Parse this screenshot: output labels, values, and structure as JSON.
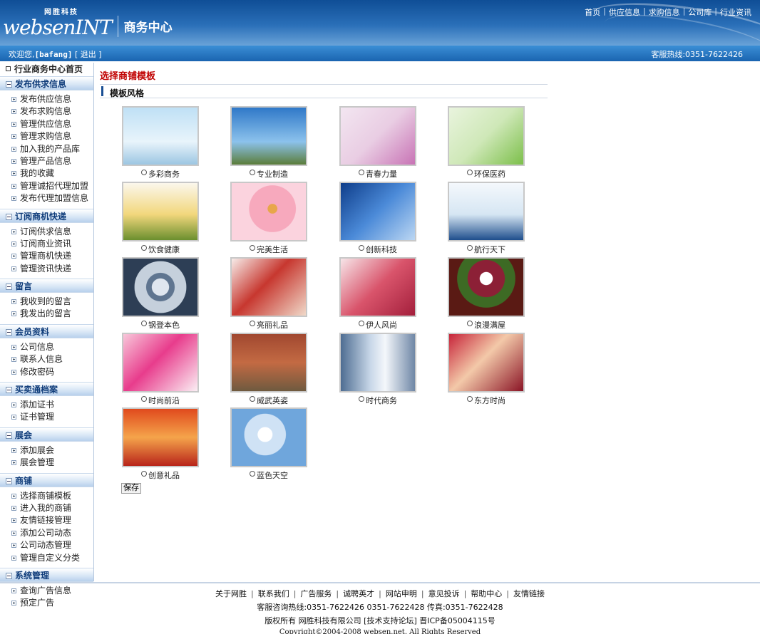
{
  "header": {
    "brand": "websenINT",
    "brand_sub": "网胜科技",
    "title": "商务中心",
    "nav": [
      "首页",
      "供应信息",
      "求购信息",
      "公司库",
      "行业资讯"
    ]
  },
  "statusbar": {
    "welcome_prefix": "欢迎您,",
    "username": "[bafang]",
    "logout": "[ 退出 ]",
    "hotline": "客服热线:0351-7622426"
  },
  "sidebar": {
    "home": "行业商务中心首页",
    "sections": [
      {
        "title": "发布供求信息",
        "items": [
          "发布供应信息",
          "发布求购信息",
          "管理供应信息",
          "管理求购信息",
          "加入我的产品库",
          "管理产品信息",
          "我的收藏",
          "管理诚招代理加盟",
          "发布代理加盟信息"
        ]
      },
      {
        "title": "订阅商机快递",
        "items": [
          "订阅供求信息",
          "订阅商业资讯",
          "管理商机快递",
          "管理资讯快递"
        ]
      },
      {
        "title": "留言",
        "items": [
          "我收到的留言",
          "我发出的留言"
        ]
      },
      {
        "title": "会员资料",
        "items": [
          "公司信息",
          "联系人信息",
          "修改密码"
        ]
      },
      {
        "title": "买卖通档案",
        "items": [
          "添加证书",
          "证书管理"
        ]
      },
      {
        "title": "展会",
        "items": [
          "添加展会",
          "展会管理"
        ]
      },
      {
        "title": "商铺",
        "items": [
          "选择商铺模板",
          "进入我的商铺",
          "友情链接管理",
          "添加公司动态",
          "公司动态管理",
          "管理自定义分类"
        ]
      },
      {
        "title": "系统管理",
        "items": [
          "查询广告信息",
          "预定广告"
        ]
      }
    ]
  },
  "main": {
    "page_title": "选择商铺模板",
    "section_label": "模板风格",
    "templates": [
      {
        "label": "多彩商务",
        "theme": "business-handshake"
      },
      {
        "label": "专业制造",
        "theme": "windmill"
      },
      {
        "label": "青春力量",
        "theme": "youth-fashion"
      },
      {
        "label": "环保医药",
        "theme": "medicine-pill"
      },
      {
        "label": "饮食健康",
        "theme": "corn-food"
      },
      {
        "label": "完美生活",
        "theme": "pink-flower"
      },
      {
        "label": "创新科技",
        "theme": "mobile-phone"
      },
      {
        "label": "航行天下",
        "theme": "cruise-ship"
      },
      {
        "label": "钢登本色",
        "theme": "steel-gears"
      },
      {
        "label": "亮丽礼品",
        "theme": "gift-box"
      },
      {
        "label": "伊人风尚",
        "theme": "lady-silk"
      },
      {
        "label": "浪漫满屋",
        "theme": "flower-bowl"
      },
      {
        "label": "时尚前沿",
        "theme": "butterfly-art"
      },
      {
        "label": "威武英姿",
        "theme": "stone-lion"
      },
      {
        "label": "时代商务",
        "theme": "skyscraper"
      },
      {
        "label": "东方时尚",
        "theme": "oriental-woman"
      },
      {
        "label": "创意礼品",
        "theme": "gift-set"
      },
      {
        "label": "蓝色天空",
        "theme": "white-dove"
      }
    ],
    "save_label": "保存"
  },
  "footer": {
    "links": [
      "关于网胜",
      "联系我们",
      "广告服务",
      "诚聘英才",
      "网站申明",
      "意见投诉",
      "帮助中心",
      "友情链接"
    ],
    "contact": "客服咨询热线:0351-7622426 0351-7622428 传真:0351-7622428",
    "company": "版权所有 网胜科技有限公司 [技术支持论坛] 晋ICP备05004115号",
    "copyright": "Copyright©2004-2008 websen.net. All Rights Reserved"
  }
}
